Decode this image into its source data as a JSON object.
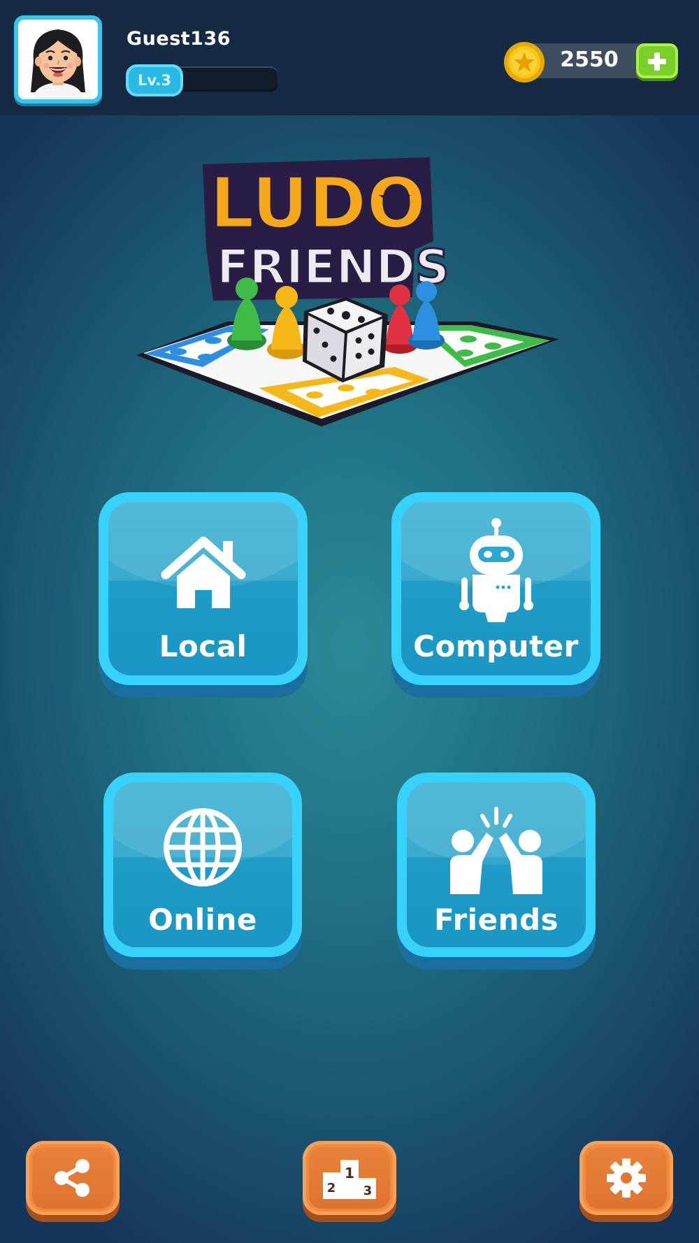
{
  "player": {
    "name": "Guest136",
    "level": "Lv.3",
    "level_progress": 0.0
  },
  "currency": {
    "coins": "2550",
    "coin_icon": "star-coin-icon",
    "add_icon": "plus-icon"
  },
  "logo": {
    "line1": "LUDO",
    "line2": "FRIENDS"
  },
  "modes": [
    {
      "label": "Local",
      "icon": "house-icon"
    },
    {
      "label": "Computer",
      "icon": "robot-icon"
    },
    {
      "label": "Online",
      "icon": "globe-icon"
    },
    {
      "label": "Friends",
      "icon": "high-five-icon"
    }
  ],
  "bottom_bar": {
    "share_icon": "share-icon",
    "podium_icon": "podium-icon",
    "podium_ranks": [
      "2",
      "1",
      "3"
    ],
    "settings_icon": "gear-icon"
  },
  "colors": {
    "accent_cyan": "#37d2fb",
    "button_orange": "#f08a3c",
    "coin_gold": "#f6c81c",
    "add_green": "#7ad02a"
  }
}
